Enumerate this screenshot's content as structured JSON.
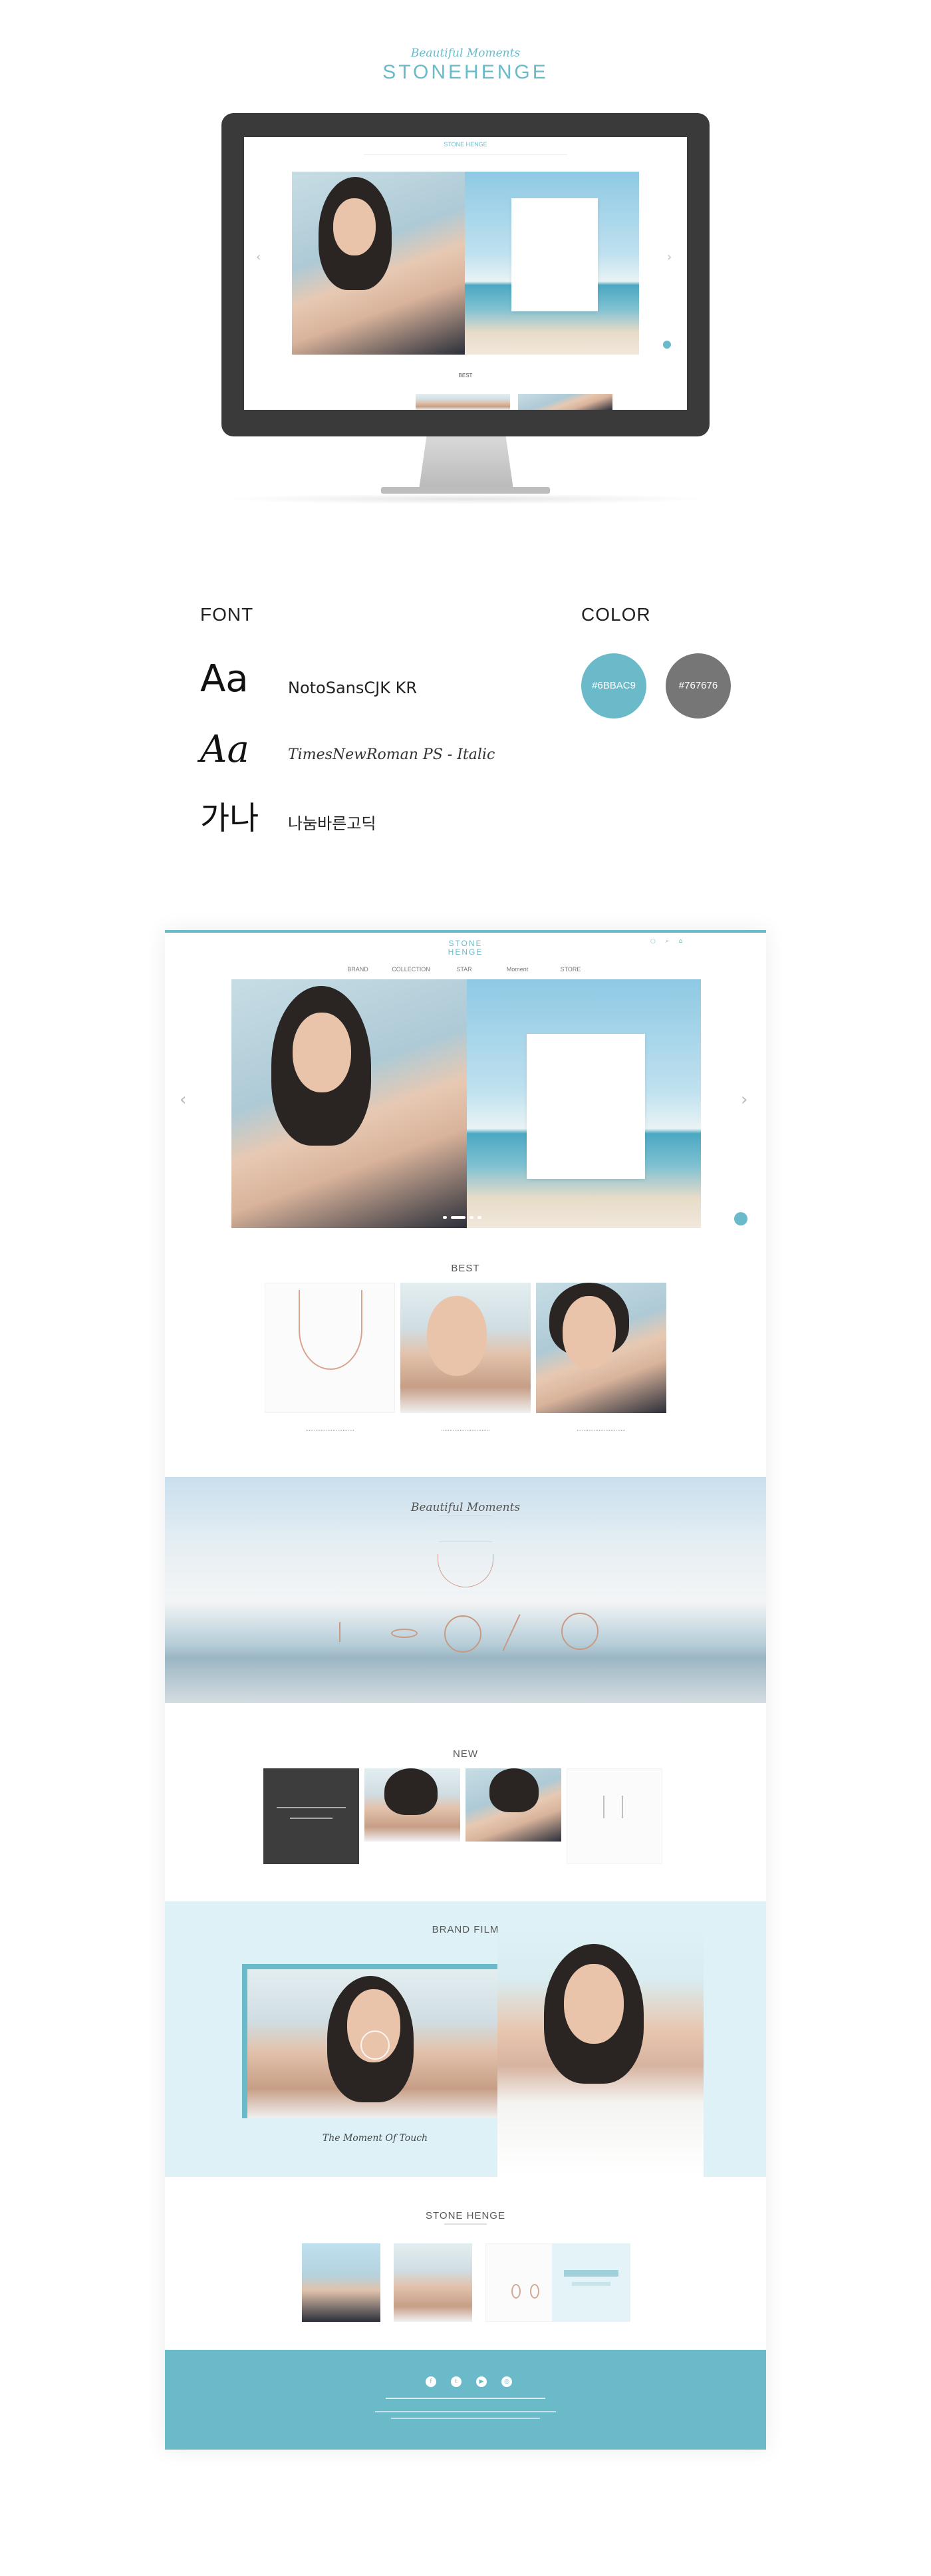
{
  "brand": {
    "tagline": "Beautiful Moments",
    "logo": "STONEHENGE",
    "accent_color": "#6bbac9",
    "gray_color": "#767676"
  },
  "monitor_preview": {
    "logo": "STONE HENGE",
    "best_label": "BEST"
  },
  "style_guide": {
    "font_heading": "FONT",
    "color_heading": "COLOR",
    "fonts": [
      {
        "sample": "Aa",
        "name": "NotoSansCJK KR"
      },
      {
        "sample": "Aa",
        "name": "TimesNewRoman PS - Italic"
      },
      {
        "sample": "가나",
        "name": "나눔바른고딕"
      }
    ],
    "colors": [
      {
        "label": "#6BBAC9",
        "hex": "#6bbac9"
      },
      {
        "label": "#767676",
        "hex": "#767676"
      }
    ]
  },
  "page": {
    "logo_top": "STONE",
    "logo_bottom": "HENGE",
    "nav": [
      "BRAND",
      "COLLECTION",
      "STAR",
      "Moment",
      "STORE"
    ],
    "sections": {
      "best": "BEST",
      "new": "NEW",
      "brand_film": "BRAND FILM",
      "stonehenge": "STONE HENGE"
    },
    "moment_title": "Beautiful Moments",
    "film_caption": "The Moment Of Touch"
  }
}
